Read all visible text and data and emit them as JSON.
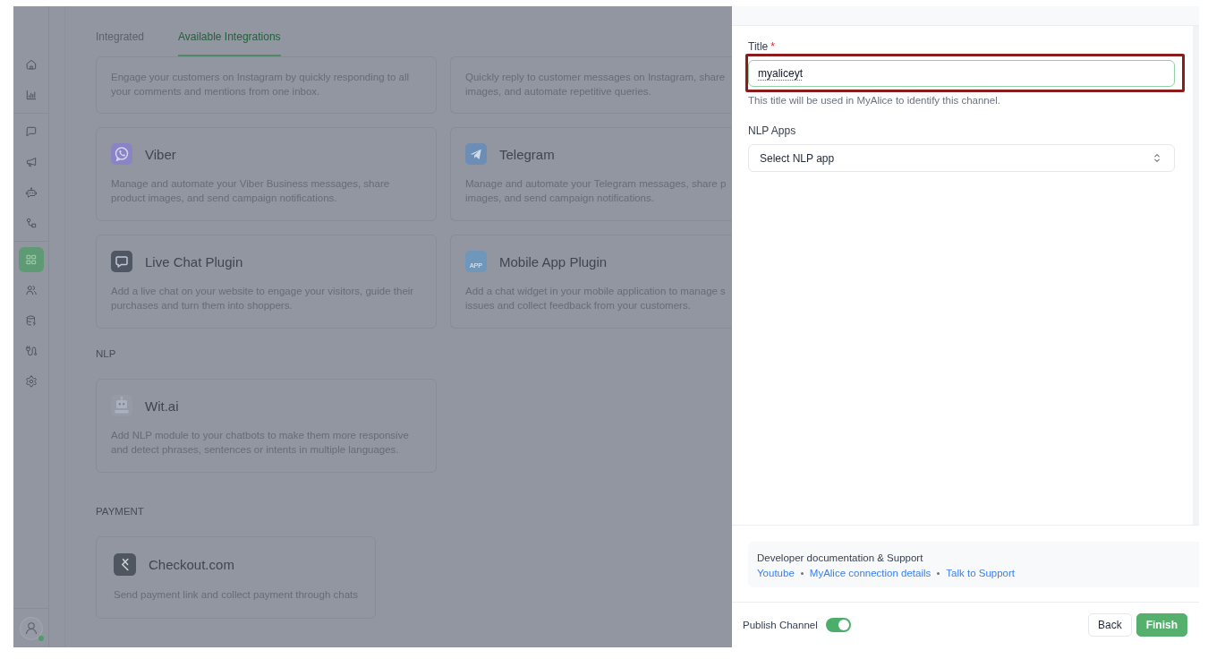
{
  "sidebar": {
    "groups": [
      {
        "items": [
          {
            "selected": false
          },
          {
            "selected": false
          }
        ]
      },
      {
        "items": [
          {
            "selected": false
          },
          {
            "selected": false
          },
          {
            "selected": false
          },
          {
            "selected": false
          }
        ]
      },
      {
        "items": [
          {
            "selected": true
          },
          {
            "selected": false
          },
          {
            "selected": false
          },
          {
            "selected": false
          },
          {
            "selected": false
          }
        ]
      }
    ],
    "user": {
      "online": true
    }
  },
  "tabs": [
    {
      "label": "Integrated",
      "selected": false
    },
    {
      "label": "Available Integrations",
      "selected": true
    }
  ],
  "sections": [
    {
      "cards": [
        {
          "description": "Engage your customers on Instagram by quickly responding to all\nyour comments and mentions from one inbox."
        },
        {
          "description": "Quickly reply to customer messages on Instagram, share\nimages, and automate repetitive queries."
        },
        {
          "kind": "phone",
          "title": "Viber",
          "description": "Manage and automate your Viber Business messages, share\nproduct images, and send campaign notifications."
        },
        {
          "kind": "plane",
          "title": "Telegram",
          "description": "Manage and automate your Telegram messages, share p\nimages, and send campaign notifications."
        },
        {
          "kind": "bubble",
          "title": "Live Chat Plugin",
          "description": "Add a live chat on your website to engage your visitors, guide their\npurchases and turn them into shoppers."
        },
        {
          "kind": "app",
          "logo_text": "APP",
          "title": "Mobile App Plugin",
          "description": "Add a chat widget in your mobile application to manage s\nissues and collect feedback from your customers."
        }
      ]
    },
    {
      "heading": "NLP",
      "cards": [
        {
          "kind": "bot",
          "title": "Wit.ai",
          "description": "Add NLP module to your chatbots to make them more responsive\nand detect phrases, sentences or intents in multiple languages."
        }
      ]
    },
    {
      "heading": "PAYMENT",
      "cards": [
        {
          "kind": "bracket",
          "title": "Checkout.com",
          "description": "Send payment link and collect payment through chats"
        }
      ]
    }
  ],
  "panel": {
    "fields": [
      {
        "kind": "text",
        "label": "Title",
        "required_mark": "*",
        "value": "myaliceyt",
        "focused": true,
        "misspelled": true,
        "highlighted": true,
        "hint": "This title will be used in MyAlice to identify this channel."
      },
      {
        "kind": "select",
        "label": "NLP Apps",
        "placeholder": "Select NLP app",
        "focused": false
      }
    ],
    "support": {
      "title": "Developer documentation & Support",
      "links": [
        "Youtube",
        "MyAlice connection details",
        "Talk to Support"
      ]
    },
    "footer": {
      "toggle": {
        "label": "Publish Channel",
        "on": true
      },
      "buttons": [
        {
          "label": "Back",
          "kind": "secondary"
        },
        {
          "label": "Finish",
          "kind": "primary"
        }
      ]
    }
  }
}
